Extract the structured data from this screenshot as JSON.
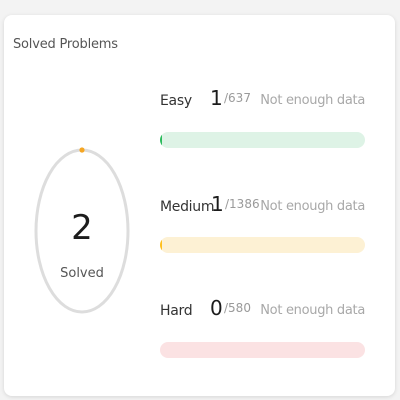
{
  "card": {
    "title": "Solved Problems"
  },
  "summary": {
    "solved_count": "2",
    "solved_label": "Solved",
    "progress_fraction": 0.0004,
    "ring_color": "#dddddd",
    "progress_color": "#f5a623"
  },
  "difficulties": [
    {
      "name": "Easy",
      "solved": "1",
      "total": "/637",
      "note": "Not enough data",
      "progress_fraction": 0.0016,
      "track_color": "#def3e6",
      "fill_color": "#2cbb5d"
    },
    {
      "name": "Medium",
      "solved": "1",
      "total": "/1386",
      "note": "Not enough data",
      "progress_fraction": 0.0007,
      "track_color": "#fdf1d4",
      "fill_color": "#ffc01e"
    },
    {
      "name": "Hard",
      "solved": "0",
      "total": "/580",
      "note": "Not enough data",
      "progress_fraction": 0,
      "track_color": "#fbe2e3",
      "fill_color": "#ef4743"
    }
  ]
}
